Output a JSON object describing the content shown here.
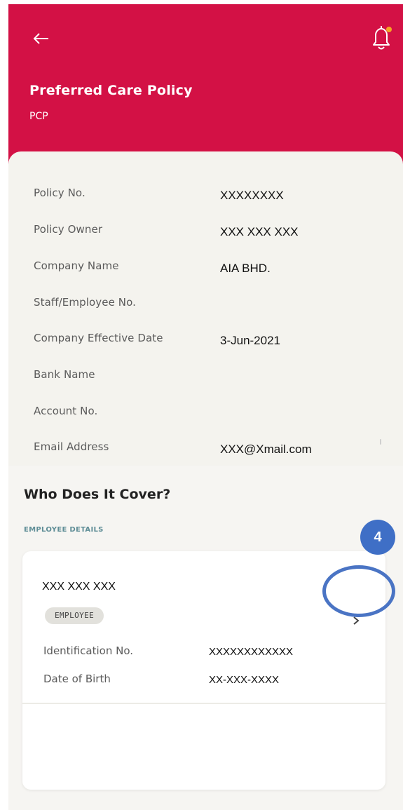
{
  "header": {
    "title": "Preferred Care Policy",
    "subtitle": "PCP"
  },
  "colors": {
    "header_bg": "#d31145",
    "notification_dot": "#f5a623",
    "callout": "#3f6fc6",
    "section_label": "#5e8d96"
  },
  "icons": {
    "back": "arrow-left-icon",
    "notifications": "bell-icon",
    "row_chevron": "chevron-right-icon"
  },
  "policy_details": [
    {
      "label": "Policy No.",
      "value": "XXXXXXXX"
    },
    {
      "label": "Policy Owner",
      "value": "XXX XXX XXX"
    },
    {
      "label": "Company Name",
      "value": "AIA BHD."
    },
    {
      "label": "Staff/Employee No.",
      "value": ""
    },
    {
      "label": "Company Effective Date",
      "value": "3-Jun-2021"
    },
    {
      "label": "Bank Name",
      "value": ""
    },
    {
      "label": "Account No.",
      "value": ""
    },
    {
      "label": "Email Address",
      "value": "XXX@Xmail.com"
    }
  ],
  "coverage": {
    "title": "Who Does It Cover?",
    "section_label": "EMPLOYEE DETAILS",
    "employee": {
      "name": "XXX XXX XXX",
      "role_badge": "EMPLOYEE",
      "rows": [
        {
          "label": "Identification No.",
          "value": "XXXXXXXXXXXX"
        },
        {
          "label": "Date of Birth",
          "value": "XX-XXX-XXXX"
        }
      ]
    }
  },
  "callout": {
    "number": "4"
  }
}
